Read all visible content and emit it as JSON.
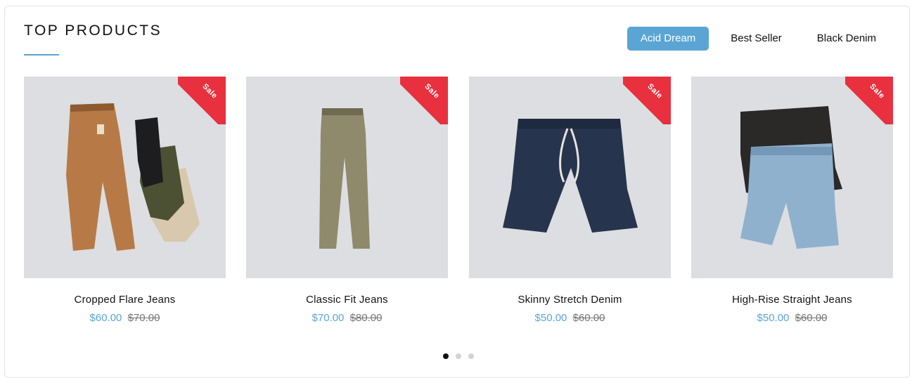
{
  "section": {
    "title": "TOP PRODUCTS"
  },
  "tabs": [
    {
      "label": "Acid Dream",
      "active": true
    },
    {
      "label": "Best Seller",
      "active": false
    },
    {
      "label": "Black Denim",
      "active": false
    }
  ],
  "products": [
    {
      "name": "Cropped Flare Jeans",
      "price": "$60.00",
      "old_price": "$70.00",
      "badge": "Sale",
      "image_icon": "pants-stack-icon"
    },
    {
      "name": "Classic Fit Jeans",
      "price": "$70.00",
      "old_price": "$80.00",
      "badge": "Sale",
      "image_icon": "straight-jeans-icon"
    },
    {
      "name": "Skinny Stretch Denim",
      "price": "$50.00",
      "old_price": "$60.00",
      "badge": "Sale",
      "image_icon": "denim-shorts-icon"
    },
    {
      "name": "High-Rise Straight Jeans",
      "price": "$50.00",
      "old_price": "$60.00",
      "badge": "Sale",
      "image_icon": "printed-shorts-icon"
    }
  ],
  "carousel": {
    "dots": 3,
    "active_index": 0
  },
  "colors": {
    "accent": "#5aa5d3",
    "sale_badge": "#e8303f",
    "image_bg": "#dcdee1",
    "old_price": "#777777"
  }
}
